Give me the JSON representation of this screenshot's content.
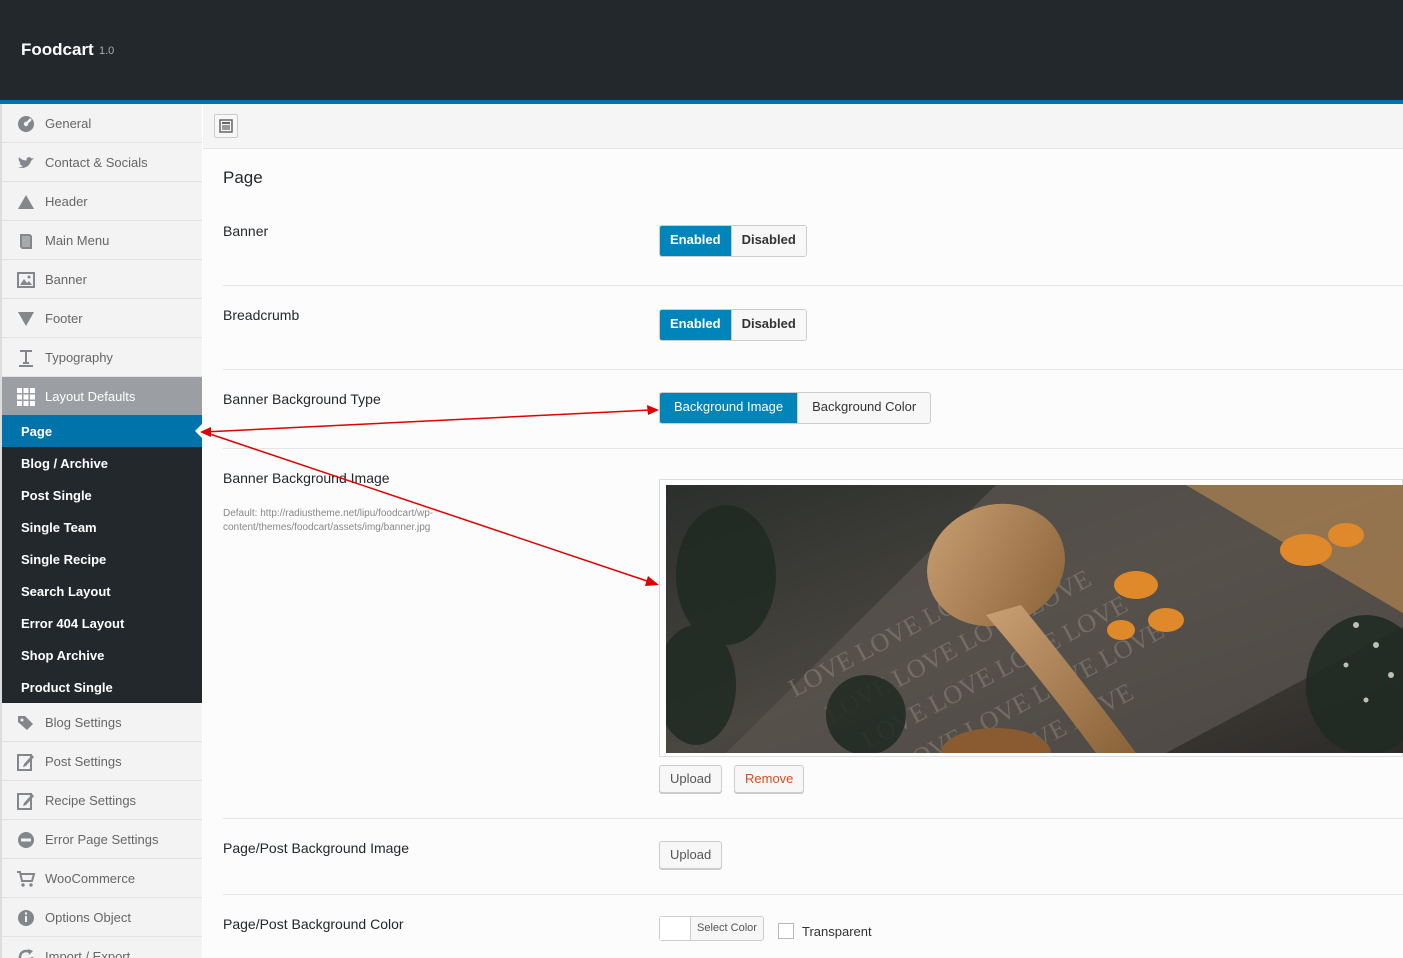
{
  "header": {
    "brand": "Foodcart",
    "version": "1.0"
  },
  "sidebar": {
    "items_top": [
      {
        "label": "General",
        "icon": "dashboard-icon"
      },
      {
        "label": "Contact & Socials",
        "icon": "twitter-icon"
      },
      {
        "label": "Header",
        "icon": "triangle-up-icon"
      },
      {
        "label": "Main Menu",
        "icon": "book-icon"
      },
      {
        "label": "Banner",
        "icon": "image-icon"
      },
      {
        "label": "Footer",
        "icon": "triangle-down-icon"
      },
      {
        "label": "Typography",
        "icon": "text-icon"
      },
      {
        "label": "Layout Defaults",
        "icon": "grid-icon"
      }
    ],
    "sub_items": [
      "Page",
      "Blog / Archive",
      "Post Single",
      "Single Team",
      "Single Recipe",
      "Search Layout",
      "Error 404 Layout",
      "Shop Archive",
      "Product Single"
    ],
    "active_sub": "Page",
    "items_bottom": [
      {
        "label": "Blog Settings",
        "icon": "tags-icon"
      },
      {
        "label": "Post Settings",
        "icon": "edit-icon"
      },
      {
        "label": "Recipe Settings",
        "icon": "edit-icon"
      },
      {
        "label": "Error Page Settings",
        "icon": "minus-circle-icon"
      },
      {
        "label": "WooCommerce",
        "icon": "cart-icon"
      },
      {
        "label": "Options Object",
        "icon": "info-icon"
      },
      {
        "label": "Import / Export",
        "icon": "refresh-icon"
      }
    ]
  },
  "main": {
    "section_title": "Page",
    "banner": {
      "label": "Banner",
      "on": "Enabled",
      "off": "Disabled",
      "selected": "Enabled"
    },
    "breadcrumb": {
      "label": "Breadcrumb",
      "on": "Enabled",
      "off": "Disabled",
      "selected": "Enabled"
    },
    "banner_bg_type": {
      "label": "Banner Background Type",
      "opt1": "Background Image",
      "opt2": "Background Color",
      "selected": "Background Image"
    },
    "banner_bg_image": {
      "label": "Banner Background Image",
      "desc": "Default: http://radiustheme.net/lipu/foodcart/wp-content/themes/foodcart/assets/img/banner.jpg",
      "upload": "Upload",
      "remove": "Remove"
    },
    "page_bg_image": {
      "label": "Page/Post Background Image",
      "upload": "Upload"
    },
    "page_bg_color": {
      "label": "Page/Post Background Color",
      "select": "Select Color",
      "transparent": "Transparent"
    }
  },
  "colors": {
    "accent": "#0085ba",
    "dark": "#23282d",
    "annotation": "#e00000"
  }
}
